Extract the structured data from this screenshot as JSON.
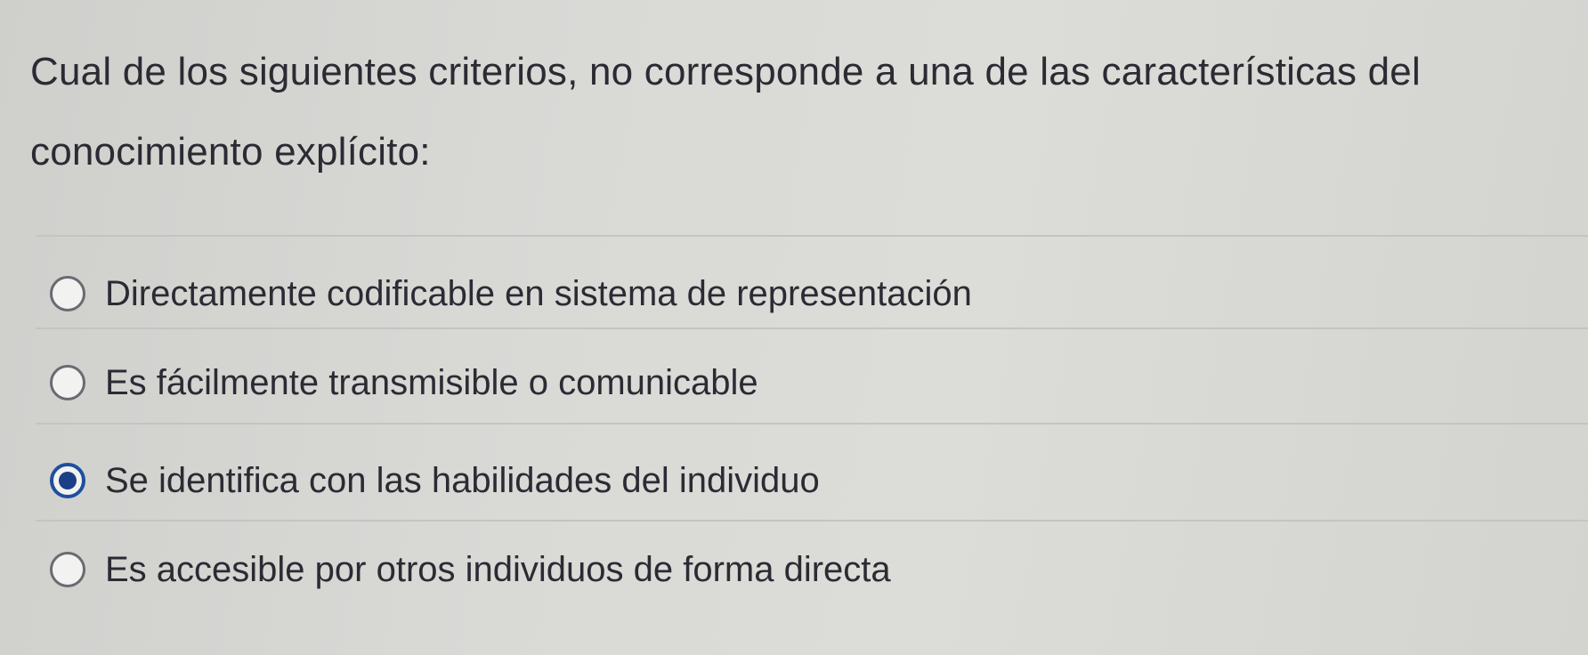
{
  "question": {
    "text": "Cual de los siguientes criterios, no corresponde a una de las características del conocimiento explícito:"
  },
  "options": [
    {
      "label": "Directamente codificable en sistema de representación",
      "selected": false
    },
    {
      "label": "Es fácilmente transmisible o comunicable",
      "selected": false
    },
    {
      "label": "Se identifica con las habilidades del individuo",
      "selected": true
    },
    {
      "label": "Es accesible por otros individuos de forma directa",
      "selected": false
    }
  ],
  "colors": {
    "background": "#d6d6d3",
    "text": "#2b2b34",
    "radio_selected": "#1a3f86",
    "divider": "#c4c4c0"
  }
}
